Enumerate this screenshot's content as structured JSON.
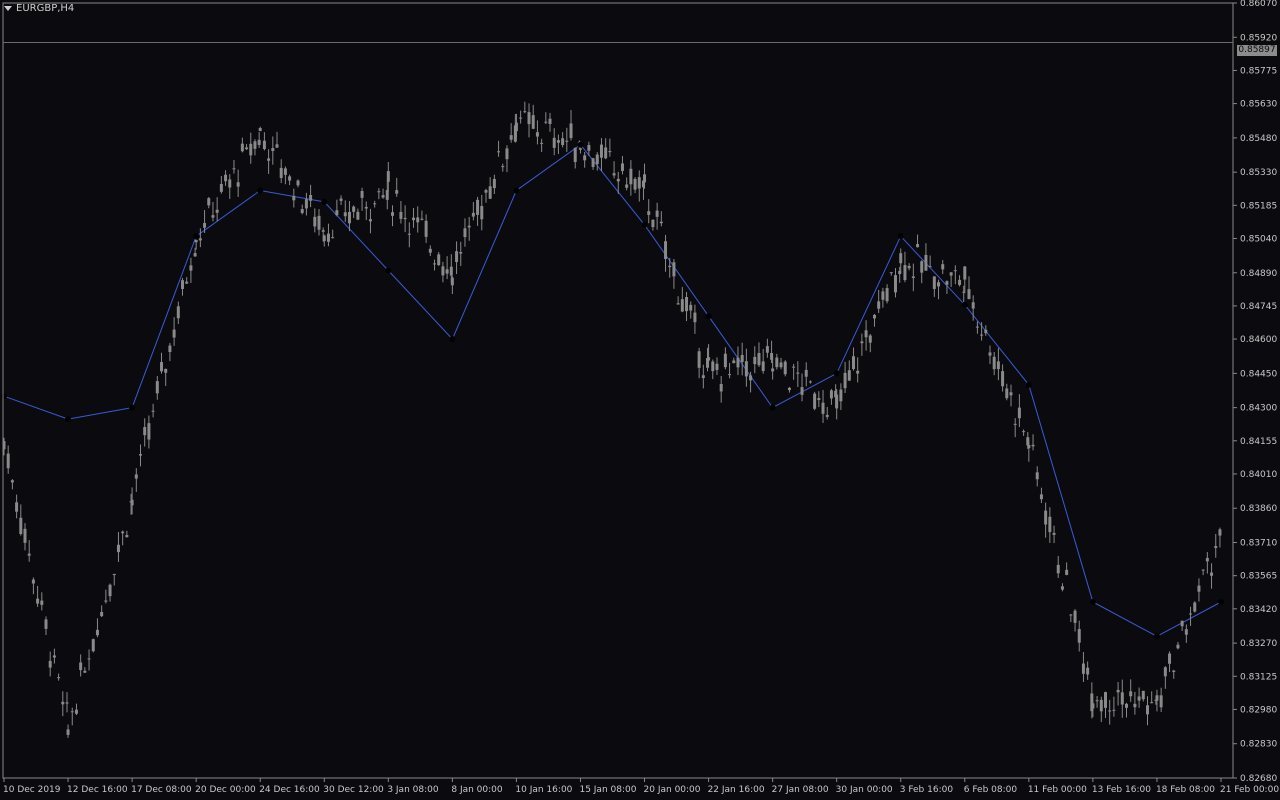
{
  "symbol": "EURGBP,H4",
  "current_price": "0.85897",
  "colors": {
    "background": "#0b0b0f",
    "axis": "#8a8a8a",
    "candle": "#8a8a8a",
    "trail_line": "#3a5bd6",
    "signal_dot": "#000000",
    "price_line": "#6a6a6a"
  },
  "chart_data": {
    "type": "line",
    "title": "",
    "xlabel": "",
    "ylabel": "",
    "y_ticks": [
      "0.86070",
      "0.85920",
      "0.85775",
      "0.85630",
      "0.85480",
      "0.85330",
      "0.85185",
      "0.85040",
      "0.84890",
      "0.84745",
      "0.84600",
      "0.84450",
      "0.84300",
      "0.84155",
      "0.84010",
      "0.83860",
      "0.83710",
      "0.83565",
      "0.83420",
      "0.83270",
      "0.83125",
      "0.82980",
      "0.82830",
      "0.82680"
    ],
    "x_ticks": [
      "10 Dec 2019",
      "12 Dec 16:00",
      "17 Dec 08:00",
      "20 Dec 00:00",
      "24 Dec 16:00",
      "30 Dec 12:00",
      "3 Jan 08:00",
      "8 Jan 00:00",
      "10 Jan 16:00",
      "15 Jan 08:00",
      "20 Jan 00:00",
      "22 Jan 16:00",
      "27 Jan 08:00",
      "30 Jan 00:00",
      "3 Feb 16:00",
      "6 Feb 08:00",
      "11 Feb 00:00",
      "13 Feb 16:00",
      "18 Feb 08:00",
      "21 Feb 00:00"
    ],
    "ylim": [
      0.8268,
      0.8607
    ],
    "price_series": [
      {
        "x": "10 Dec 2019",
        "y": 0.8415
      },
      {
        "x": "12 Dec 16:00",
        "y": 0.829
      },
      {
        "x": "17 Dec 08:00",
        "y": 0.839
      },
      {
        "x": "20 Dec 00:00",
        "y": 0.8505
      },
      {
        "x": "24 Dec 16:00",
        "y": 0.855
      },
      {
        "x": "30 Dec 12:00",
        "y": 0.8508
      },
      {
        "x": "3 Jan 08:00",
        "y": 0.8525
      },
      {
        "x": "8 Jan 00:00",
        "y": 0.849
      },
      {
        "x": "10 Jan 16:00",
        "y": 0.8555
      },
      {
        "x": "15 Jan 08:00",
        "y": 0.8545
      },
      {
        "x": "20 Jan 00:00",
        "y": 0.8525
      },
      {
        "x": "22 Jan 16:00",
        "y": 0.8445
      },
      {
        "x": "27 Jan 08:00",
        "y": 0.845
      },
      {
        "x": "30 Jan 00:00",
        "y": 0.843
      },
      {
        "x": "3 Feb 16:00",
        "y": 0.8495
      },
      {
        "x": "6 Feb 08:00",
        "y": 0.8485
      },
      {
        "x": "11 Feb 00:00",
        "y": 0.8415
      },
      {
        "x": "13 Feb 16:00",
        "y": 0.8305
      },
      {
        "x": "18 Feb 08:00",
        "y": 0.83
      },
      {
        "x": "21 Feb 00:00",
        "y": 0.8375
      }
    ],
    "trail_series": [
      {
        "x": "10 Dec 2019",
        "y": 0.8435
      },
      {
        "x": "12 Dec 16:00",
        "y": 0.8425
      },
      {
        "x": "17 Dec 08:00",
        "y": 0.843
      },
      {
        "x": "20 Dec 00:00",
        "y": 0.8505
      },
      {
        "x": "24 Dec 16:00",
        "y": 0.8525
      },
      {
        "x": "30 Dec 12:00",
        "y": 0.852
      },
      {
        "x": "3 Jan 08:00",
        "y": 0.849
      },
      {
        "x": "8 Jan 00:00",
        "y": 0.846
      },
      {
        "x": "10 Jan 16:00",
        "y": 0.8525
      },
      {
        "x": "15 Jan 08:00",
        "y": 0.8545
      },
      {
        "x": "20 Jan 00:00",
        "y": 0.851
      },
      {
        "x": "22 Jan 16:00",
        "y": 0.847
      },
      {
        "x": "27 Jan 08:00",
        "y": 0.843
      },
      {
        "x": "30 Jan 00:00",
        "y": 0.8445
      },
      {
        "x": "3 Feb 16:00",
        "y": 0.8505
      },
      {
        "x": "6 Feb 08:00",
        "y": 0.8475
      },
      {
        "x": "11 Feb 00:00",
        "y": 0.844
      },
      {
        "x": "13 Feb 16:00",
        "y": 0.8345
      },
      {
        "x": "18 Feb 08:00",
        "y": 0.833
      },
      {
        "x": "21 Feb 00:00",
        "y": 0.8345
      }
    ],
    "grid": false,
    "legend": "none"
  }
}
